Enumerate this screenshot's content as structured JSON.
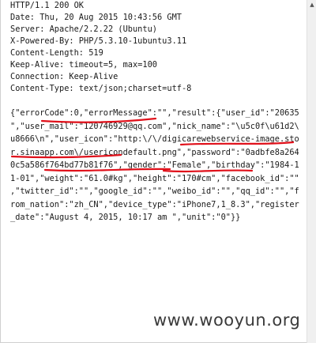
{
  "headers": [
    "HTTP/1.1 200 OK",
    "Date: Thu, 20 Aug 2015 10:43:56 GMT",
    "Server: Apache/2.2.22 (Ubuntu)",
    "X-Powered-By: PHP/5.3.10-1ubuntu3.11",
    "Content-Length: 519",
    "Keep-Alive: timeout=5, max=100",
    "Connection: Keep-Alive",
    "Content-Type: text/json;charset=utf-8"
  ],
  "body_lines": [
    "{\"errorCode\":0,\"errorMessage\":\"\",\"result\":{\"user_id\":\"20635",
    "\",\"user_mail\":\"120746929@qq.com\",\"nick_name\":\"\\u5c0f\\u61d2\\",
    "u8666\\n\",\"user_icon\":\"http:\\/\\/digicarewebservice-image.sto",
    "r.sinaapp.com\\/usericondefault.png\",\"password\":\"0adbfe8a264",
    "0c5a586f764bd77b81f76\",\"gender\":\"Female\",\"birthday\":\"1984-1",
    "1-01\",\"weight\":\"61.0#kg\",\"height\":\"170#cm\",\"facebook_id\":\"\"",
    ",\"twitter_id\":\"\",\"google_id\":\"\",\"weibo_id\":\"\",\"qq_id\":\"\",\"f",
    "rom_nation\":\"zh_CN\",\"device_type\":\"iPhone7,1_8.3\",\"register",
    "_date\":\"August 4, 2015, 10:17 am \",\"unit\":\"0\"}}"
  ],
  "watermark": "www.wooyun.org",
  "annotation_color": "#e0101a",
  "icons": {
    "scroll_up": "triangle-up-icon"
  }
}
